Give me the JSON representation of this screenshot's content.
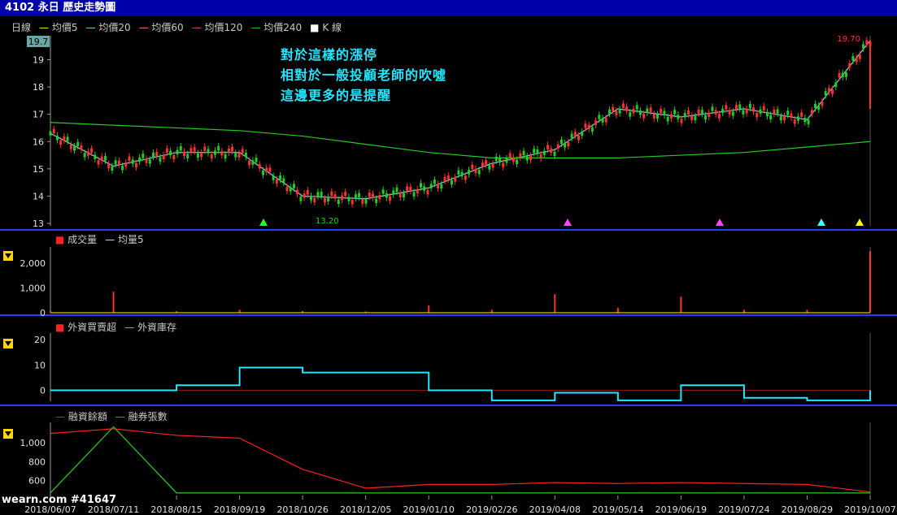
{
  "window": {
    "title": "4102 永日  歷史走勢圖"
  },
  "price_panel": {
    "legend": [
      {
        "label": "日線",
        "color": "#ffffff",
        "mark": ""
      },
      {
        "label": "均價5",
        "color": "#ffff00",
        "mark": "—"
      },
      {
        "label": "均價20",
        "color": "#7fd4ff",
        "mark": "—"
      },
      {
        "label": "均價60",
        "color": "#ff66cc",
        "mark": "—"
      },
      {
        "label": "均價120",
        "color": "#cc44cc",
        "mark": "—"
      },
      {
        "label": "均價240",
        "color": "#22cc22",
        "mark": "—"
      },
      {
        "label": "K 線",
        "color": "#ffffff",
        "mark": "■"
      }
    ],
    "annotation": [
      "對於這樣的漲停",
      "相對於一般投顧老師的吹噓",
      "這邊更多的是提醒"
    ],
    "last_price_box": "19.7",
    "high_label": "19.70",
    "low_label": "13.20",
    "yticks": [
      "13",
      "14",
      "15",
      "16",
      "17",
      "18",
      "19"
    ]
  },
  "volume_panel": {
    "legend": [
      {
        "label": "成交量",
        "color": "#ff2020",
        "mark": "■"
      },
      {
        "label": "均量5",
        "color": "#ffff00",
        "mark": "—"
      }
    ],
    "yticks": [
      "0",
      "1,000",
      "2,000"
    ]
  },
  "foreign_panel": {
    "legend": [
      {
        "label": "外資買賣超",
        "color": "#ff2020",
        "mark": "■"
      },
      {
        "label": "外資庫存",
        "color": "#22e6ff",
        "mark": "—"
      }
    ],
    "yticks": [
      "0",
      "10",
      "20"
    ]
  },
  "margin_panel": {
    "legend": [
      {
        "label": "融資餘額",
        "color": "#ff2020",
        "mark": "—"
      },
      {
        "label": "融券張數",
        "color": "#22cc22",
        "mark": "—"
      }
    ],
    "yticks": [
      "600",
      "800",
      "1,000"
    ]
  },
  "x_dates": [
    "2018/06/07",
    "2018/07/11",
    "2018/08/15",
    "2018/09/19",
    "2018/10/26",
    "2018/12/05",
    "2019/01/10",
    "2019/02/26",
    "2019/04/08",
    "2019/05/14",
    "2019/06/19",
    "2019/07/24",
    "2019/08/29",
    "2019/10/07"
  ],
  "watermark": "wearn.com #41647",
  "chart_data": [
    {
      "type": "line",
      "title": "歷史走勢圖",
      "x": [
        "2018/06/07",
        "2018/07/11",
        "2018/08/15",
        "2018/09/19",
        "2018/10/26",
        "2018/12/05",
        "2019/01/10",
        "2019/02/26",
        "2019/04/08",
        "2019/05/14",
        "2019/06/19",
        "2019/07/24",
        "2019/08/29",
        "2019/10/07"
      ],
      "ylim": [
        13,
        19.7
      ],
      "series": [
        {
          "name": "K 線",
          "values": [
            16.3,
            15.1,
            15.6,
            15.6,
            14.0,
            13.9,
            14.3,
            15.2,
            15.7,
            17.2,
            16.9,
            17.2,
            16.8,
            19.7
          ]
        },
        {
          "name": "均價240",
          "values": [
            16.7,
            16.6,
            16.5,
            16.4,
            16.2,
            15.9,
            15.6,
            15.4,
            15.4,
            15.4,
            15.5,
            15.6,
            15.8,
            16.0
          ]
        }
      ]
    },
    {
      "type": "bar",
      "title": "成交量",
      "categories": [
        "2018/06/07",
        "2018/07/11",
        "2018/08/15",
        "2018/09/19",
        "2018/10/26",
        "2018/12/05",
        "2019/01/10",
        "2019/02/26",
        "2019/04/08",
        "2019/05/14",
        "2019/06/19",
        "2019/07/24",
        "2019/08/29",
        "2019/10/07"
      ],
      "values": [
        80,
        850,
        60,
        120,
        70,
        50,
        300,
        120,
        750,
        200,
        650,
        120,
        120,
        2500
      ],
      "ylim": [
        0,
        2600
      ]
    },
    {
      "type": "line",
      "title": "外資買賣超",
      "x": [
        "2018/06/07",
        "2018/07/11",
        "2018/08/15",
        "2018/09/19",
        "2018/10/26",
        "2018/12/05",
        "2019/01/10",
        "2019/02/26",
        "2019/04/08",
        "2019/05/14",
        "2019/06/19",
        "2019/07/24",
        "2019/08/29",
        "2019/10/07"
      ],
      "series": [
        {
          "name": "外資庫存",
          "values": [
            0,
            0,
            2,
            9,
            7,
            7,
            0,
            -4,
            -1,
            -4,
            2,
            -3,
            -4,
            0
          ]
        }
      ],
      "ylim": [
        -5,
        22
      ]
    },
    {
      "type": "line",
      "title": "融資餘額",
      "x": [
        "2018/06/07",
        "2018/07/11",
        "2018/08/15",
        "2018/09/19",
        "2018/10/26",
        "2018/12/05",
        "2019/01/10",
        "2019/02/26",
        "2019/04/08",
        "2019/05/14",
        "2019/06/19",
        "2019/07/24",
        "2019/08/29",
        "2019/10/07"
      ],
      "series": [
        {
          "name": "融資餘額",
          "values": [
            1100,
            1150,
            1080,
            1050,
            720,
            520,
            560,
            560,
            580,
            570,
            580,
            570,
            560,
            480
          ]
        },
        {
          "name": "融券張數",
          "values": [
            470,
            1170,
            470,
            470,
            470,
            470,
            470,
            470,
            470,
            470,
            470,
            470,
            470,
            470
          ]
        }
      ],
      "ylim": [
        460,
        1200
      ]
    }
  ]
}
